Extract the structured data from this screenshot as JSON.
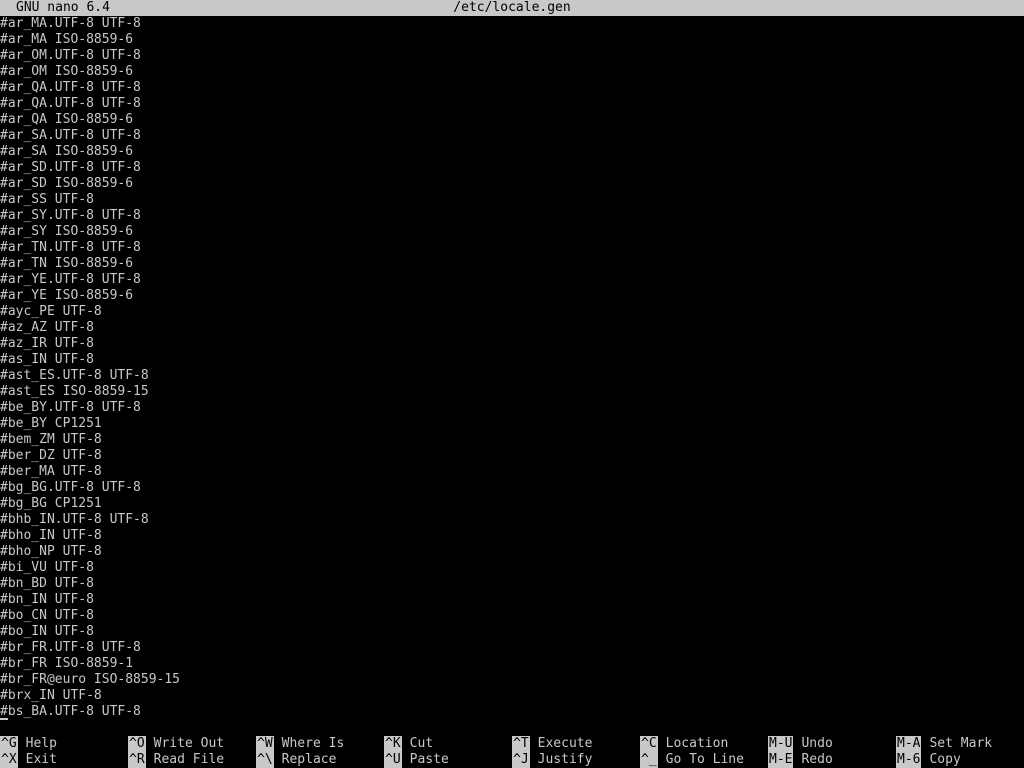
{
  "titlebar": {
    "app": "GNU nano 6.4",
    "filename": "/etc/locale.gen"
  },
  "buffer": {
    "lines": [
      "#ar_MA.UTF-8 UTF-8",
      "#ar_MA ISO-8859-6",
      "#ar_OM.UTF-8 UTF-8",
      "#ar_OM ISO-8859-6",
      "#ar_QA.UTF-8 UTF-8",
      "#ar_QA.UTF-8 UTF-8",
      "#ar_QA ISO-8859-6",
      "#ar_SA.UTF-8 UTF-8",
      "#ar_SA ISO-8859-6",
      "#ar_SD.UTF-8 UTF-8",
      "#ar_SD ISO-8859-6",
      "#ar_SS UTF-8",
      "#ar_SY.UTF-8 UTF-8",
      "#ar_SY ISO-8859-6",
      "#ar_TN.UTF-8 UTF-8",
      "#ar_TN ISO-8859-6",
      "#ar_YE.UTF-8 UTF-8",
      "#ar_YE ISO-8859-6",
      "#ayc_PE UTF-8",
      "#az_AZ UTF-8",
      "#az_IR UTF-8",
      "#as_IN UTF-8",
      "#ast_ES.UTF-8 UTF-8",
      "#ast_ES ISO-8859-15",
      "#be_BY.UTF-8 UTF-8",
      "#be_BY CP1251",
      "#bem_ZM UTF-8",
      "#ber_DZ UTF-8",
      "#ber_MA UTF-8",
      "#bg_BG.UTF-8 UTF-8",
      "#bg_BG CP1251",
      "#bhb_IN.UTF-8 UTF-8",
      "#bho_IN UTF-8",
      "#bho_NP UTF-8",
      "#bi_VU UTF-8",
      "#bn_BD UTF-8",
      "#bn_IN UTF-8",
      "#bo_CN UTF-8",
      "#bo_IN UTF-8",
      "#br_FR.UTF-8 UTF-8",
      "#br_FR ISO-8859-1",
      "#br_FR@euro ISO-8859-15",
      "#brx_IN UTF-8",
      "#bs_BA.UTF-8 UTF-8"
    ]
  },
  "statusbar": {
    "message": ""
  },
  "shortcuts": {
    "row1": [
      {
        "key": "^G",
        "label": "Help"
      },
      {
        "key": "^O",
        "label": "Write Out"
      },
      {
        "key": "^W",
        "label": "Where Is"
      },
      {
        "key": "^K",
        "label": "Cut"
      },
      {
        "key": "^T",
        "label": "Execute"
      },
      {
        "key": "^C",
        "label": "Location"
      },
      {
        "key": "M-U",
        "label": "Undo"
      },
      {
        "key": "M-A",
        "label": "Set Mark"
      }
    ],
    "row2": [
      {
        "key": "^X",
        "label": "Exit"
      },
      {
        "key": "^R",
        "label": "Read File"
      },
      {
        "key": "^\\",
        "label": "Replace"
      },
      {
        "key": "^U",
        "label": "Paste"
      },
      {
        "key": "^J",
        "label": "Justify"
      },
      {
        "key": "^_",
        "label": "Go To Line"
      },
      {
        "key": "M-E",
        "label": "Redo"
      },
      {
        "key": "M-6",
        "label": "Copy"
      }
    ]
  },
  "colors": {
    "background": "#000000",
    "foreground": "#c8c8c8",
    "inverse_bg": "#c8c8c8",
    "inverse_fg": "#000000"
  }
}
